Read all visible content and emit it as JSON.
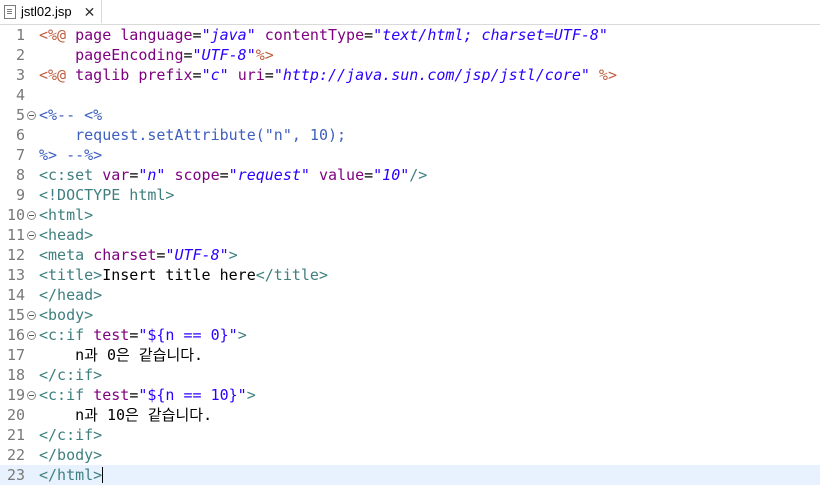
{
  "tab": {
    "filename": "jstl02.jsp",
    "close_glyph": "✕"
  },
  "lines": [
    {
      "n": "1",
      "fold": false,
      "tokens": [
        [
          "jsp",
          "<%@"
        ],
        [
          "txt",
          " "
        ],
        [
          "attr",
          "page"
        ],
        [
          "txt",
          " "
        ],
        [
          "attr",
          "language"
        ],
        [
          "txt",
          "="
        ],
        [
          "str",
          "\"java\""
        ],
        [
          "txt",
          " "
        ],
        [
          "attr",
          "contentType"
        ],
        [
          "txt",
          "="
        ],
        [
          "str",
          "\"text/html; charset=UTF-8\""
        ]
      ]
    },
    {
      "n": "2",
      "fold": false,
      "tokens": [
        [
          "txt",
          "    "
        ],
        [
          "attr",
          "pageEncoding"
        ],
        [
          "txt",
          "="
        ],
        [
          "str",
          "\"UTF-8\""
        ],
        [
          "jsp",
          "%>"
        ]
      ]
    },
    {
      "n": "3",
      "fold": false,
      "tokens": [
        [
          "jsp",
          "<%@"
        ],
        [
          "txt",
          " "
        ],
        [
          "attr",
          "taglib"
        ],
        [
          "txt",
          " "
        ],
        [
          "attr",
          "prefix"
        ],
        [
          "txt",
          "="
        ],
        [
          "str",
          "\"c\""
        ],
        [
          "txt",
          " "
        ],
        [
          "attr",
          "uri"
        ],
        [
          "txt",
          "="
        ],
        [
          "str",
          "\"http://java.sun.com/jsp/jstl/core\""
        ],
        [
          "txt",
          " "
        ],
        [
          "jsp",
          "%>"
        ]
      ]
    },
    {
      "n": "4",
      "fold": false,
      "tokens": []
    },
    {
      "n": "5",
      "fold": true,
      "tokens": [
        [
          "cmt",
          "<%-- <%"
        ]
      ]
    },
    {
      "n": "6",
      "fold": false,
      "tokens": [
        [
          "cmt",
          "    request.setAttribute(\"n\", 10);"
        ]
      ]
    },
    {
      "n": "7",
      "fold": false,
      "tokens": [
        [
          "cmt",
          "%> --%>"
        ]
      ]
    },
    {
      "n": "8",
      "fold": false,
      "tokens": [
        [
          "tag",
          "<c:set"
        ],
        [
          "txt",
          " "
        ],
        [
          "attr",
          "var"
        ],
        [
          "txt",
          "="
        ],
        [
          "str",
          "\"n\""
        ],
        [
          "txt",
          " "
        ],
        [
          "attr",
          "scope"
        ],
        [
          "txt",
          "="
        ],
        [
          "str",
          "\"request\""
        ],
        [
          "txt",
          " "
        ],
        [
          "attr",
          "value"
        ],
        [
          "txt",
          "="
        ],
        [
          "str",
          "\"10\""
        ],
        [
          "tag",
          "/>"
        ]
      ]
    },
    {
      "n": "9",
      "fold": false,
      "tokens": [
        [
          "tag",
          "<!DOCTYPE html>"
        ]
      ]
    },
    {
      "n": "10",
      "fold": true,
      "tokens": [
        [
          "tag",
          "<html>"
        ]
      ]
    },
    {
      "n": "11",
      "fold": true,
      "tokens": [
        [
          "tag",
          "<head>"
        ]
      ]
    },
    {
      "n": "12",
      "fold": false,
      "tokens": [
        [
          "tag",
          "<meta"
        ],
        [
          "txt",
          " "
        ],
        [
          "attr",
          "charset"
        ],
        [
          "txt",
          "="
        ],
        [
          "str",
          "\"UTF-8\""
        ],
        [
          "tag",
          ">"
        ]
      ]
    },
    {
      "n": "13",
      "fold": false,
      "tokens": [
        [
          "tag",
          "<title>"
        ],
        [
          "txt",
          "Insert title here"
        ],
        [
          "tag",
          "</title>"
        ]
      ]
    },
    {
      "n": "14",
      "fold": false,
      "tokens": [
        [
          "tag",
          "</head>"
        ]
      ]
    },
    {
      "n": "15",
      "fold": true,
      "tokens": [
        [
          "tag",
          "<body>"
        ]
      ]
    },
    {
      "n": "16",
      "fold": true,
      "tokens": [
        [
          "tag",
          "<c:if"
        ],
        [
          "txt",
          " "
        ],
        [
          "attr",
          "test"
        ],
        [
          "txt",
          "="
        ],
        [
          "strn",
          "\"${n == 0}\""
        ],
        [
          "tag",
          ">"
        ]
      ]
    },
    {
      "n": "17",
      "fold": false,
      "tokens": [
        [
          "txt",
          "    n과 0은 같습니다."
        ]
      ]
    },
    {
      "n": "18",
      "fold": false,
      "tokens": [
        [
          "tag",
          "</c:if>"
        ]
      ]
    },
    {
      "n": "19",
      "fold": true,
      "tokens": [
        [
          "tag",
          "<c:if"
        ],
        [
          "txt",
          " "
        ],
        [
          "attr",
          "test"
        ],
        [
          "txt",
          "="
        ],
        [
          "strn",
          "\"${n == 10}\""
        ],
        [
          "tag",
          ">"
        ]
      ]
    },
    {
      "n": "20",
      "fold": false,
      "tokens": [
        [
          "txt",
          "    n과 10은 같습니다."
        ]
      ]
    },
    {
      "n": "21",
      "fold": false,
      "tokens": [
        [
          "tag",
          "</c:if>"
        ]
      ]
    },
    {
      "n": "22",
      "fold": false,
      "tokens": [
        [
          "tag",
          "</body>"
        ]
      ]
    },
    {
      "n": "23",
      "fold": false,
      "current": true,
      "caret": true,
      "tokens": [
        [
          "tag",
          "</html>"
        ]
      ]
    }
  ],
  "colors": {
    "tag": "#3f7f7f",
    "attr": "#7f007f",
    "string": "#2a00ff",
    "jsp": "#bf5f3f",
    "comment": "#3f5fbf",
    "line_number": "#787878",
    "current_line": "#e8f2fe"
  },
  "icons": {
    "file": "file-icon",
    "close": "close-icon",
    "fold": "fold-toggle-icon"
  }
}
